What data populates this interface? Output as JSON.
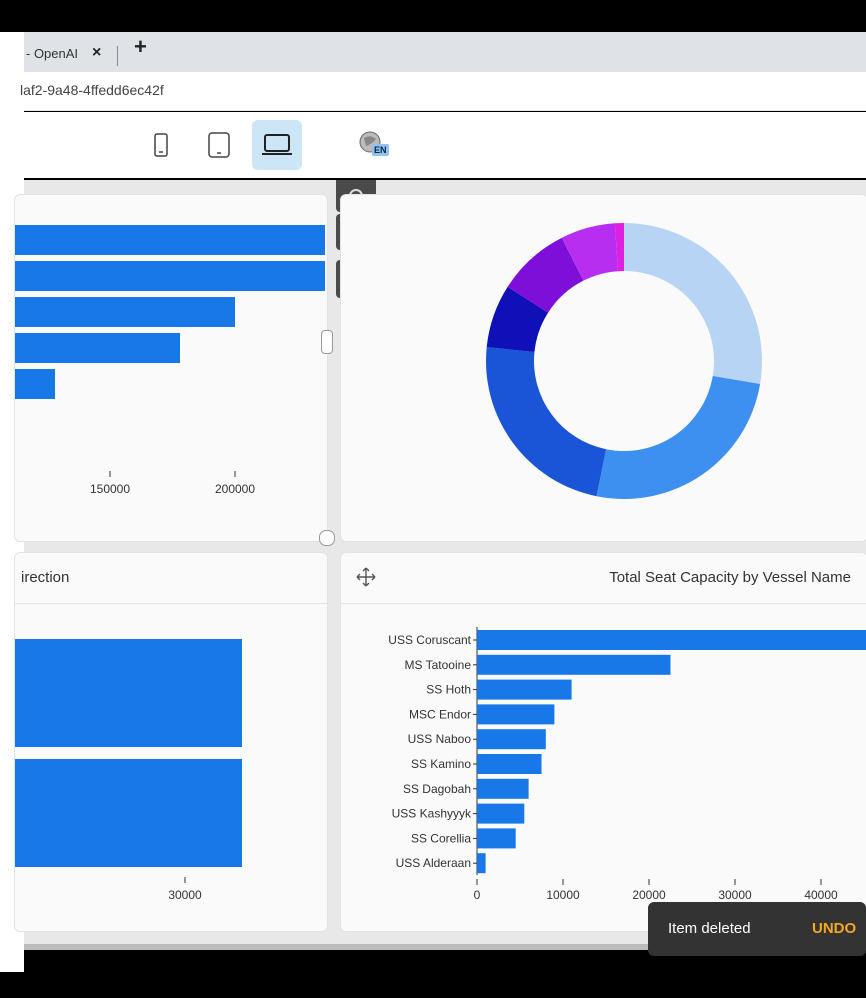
{
  "browser": {
    "tab_title": "- OpenAI",
    "tab_close": "×",
    "new_tab": "+",
    "url": "laf2-9a48-4ffedd6ec42f"
  },
  "toolbar": {
    "devices": [
      "mobile-portrait",
      "tablet",
      "laptop"
    ],
    "active_device": "laptop",
    "language_badge": "EN"
  },
  "panels": {
    "top_left": {
      "ticks": [
        "150000",
        "200000"
      ]
    },
    "bottom_left": {
      "title": "irection",
      "ticks": [
        "30000"
      ]
    },
    "bottom_right": {
      "title": "Total Seat Capacity by Vessel Name"
    }
  },
  "snackbar": {
    "message": "Item deleted",
    "action": "UNDO"
  },
  "colors": {
    "bar": "#1878e8",
    "accent": "#cce6f7",
    "undo": "#f5a623"
  },
  "chart_data": [
    {
      "type": "bar",
      "orientation": "horizontal",
      "values": [
        236000,
        236000,
        200000,
        178000,
        128000
      ],
      "x_ticks": [
        150000,
        200000
      ]
    },
    {
      "type": "pie",
      "style": "donut",
      "slices": [
        {
          "color": "#b8d4f5",
          "value": 26
        },
        {
          "color": "#3d8ff0",
          "value": 24
        },
        {
          "color": "#1a55d8",
          "value": 22
        },
        {
          "color": "#1010b8",
          "value": 7
        },
        {
          "color": "#7d0fd9",
          "value": 8
        },
        {
          "color": "#b72ef0",
          "value": 6
        },
        {
          "color": "#e020e0",
          "value": 1
        }
      ]
    },
    {
      "type": "bar",
      "orientation": "horizontal",
      "values": [
        39000,
        39000
      ],
      "x_ticks": [
        30000
      ]
    },
    {
      "type": "bar",
      "orientation": "horizontal",
      "title": "Total Seat Capacity by Vessel Name",
      "categories": [
        "USS Coruscant",
        "MS Tatooine",
        "SS Hoth",
        "MSC Endor",
        "USS Naboo",
        "SS Kamino",
        "SS Dagobah",
        "USS Kashyyyk",
        "SS Corellia",
        "USS Alderaan"
      ],
      "values": [
        46000,
        22500,
        11000,
        9000,
        8000,
        7500,
        6000,
        5500,
        4500,
        1000
      ],
      "x_ticks": [
        0,
        10000,
        20000,
        30000,
        40000
      ]
    }
  ]
}
